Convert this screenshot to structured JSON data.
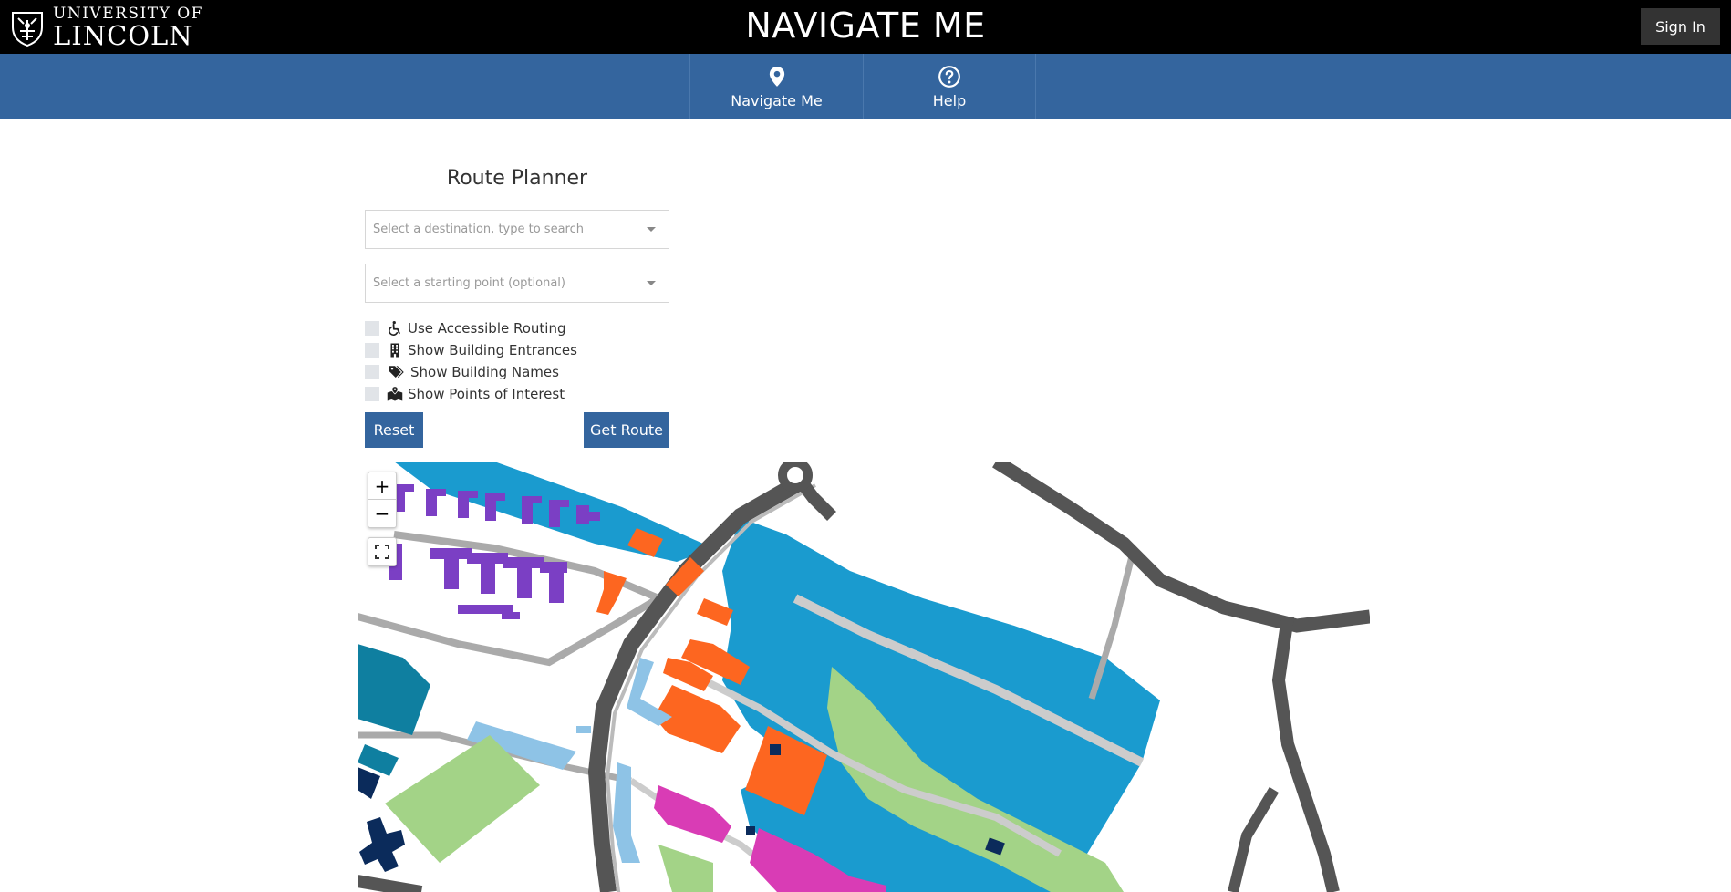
{
  "header": {
    "logo_line1": "UNIVERSITY OF",
    "logo_line2": "LINCOLN",
    "app_title": "NAVIGATE ME",
    "sign_in_label": "Sign In"
  },
  "nav": {
    "items": [
      {
        "label": "Navigate Me",
        "icon": "map-pin-icon"
      },
      {
        "label": "Help",
        "icon": "question-circle-icon"
      }
    ]
  },
  "planner": {
    "title": "Route Planner",
    "destination_placeholder": "Select a destination, type to search",
    "start_placeholder": "Select a starting point (optional)",
    "options": [
      {
        "label": "Use Accessible Routing",
        "icon": "wheelchair-icon",
        "checked": false
      },
      {
        "label": "Show Building Entrances",
        "icon": "building-icon",
        "checked": false
      },
      {
        "label": "Show Building Names",
        "icon": "tags-icon",
        "checked": false
      },
      {
        "label": "Show Points of Interest",
        "icon": "map-marked-icon",
        "checked": false
      }
    ],
    "reset_label": "Reset",
    "get_route_label": "Get Route"
  },
  "map": {
    "zoom_in_label": "+",
    "zoom_out_label": "−",
    "colors": {
      "water": "#1a9bcf",
      "grass": "#a3d387",
      "road_dark": "#555555",
      "road_light": "#cccccc",
      "building_orange": "#fd6620",
      "building_purple": "#7b3fc4",
      "building_pink": "#d93cb5",
      "building_teal": "#0f7fa0",
      "building_navy": "#0b2b5b",
      "building_lightblue": "#8ec3e6"
    }
  }
}
